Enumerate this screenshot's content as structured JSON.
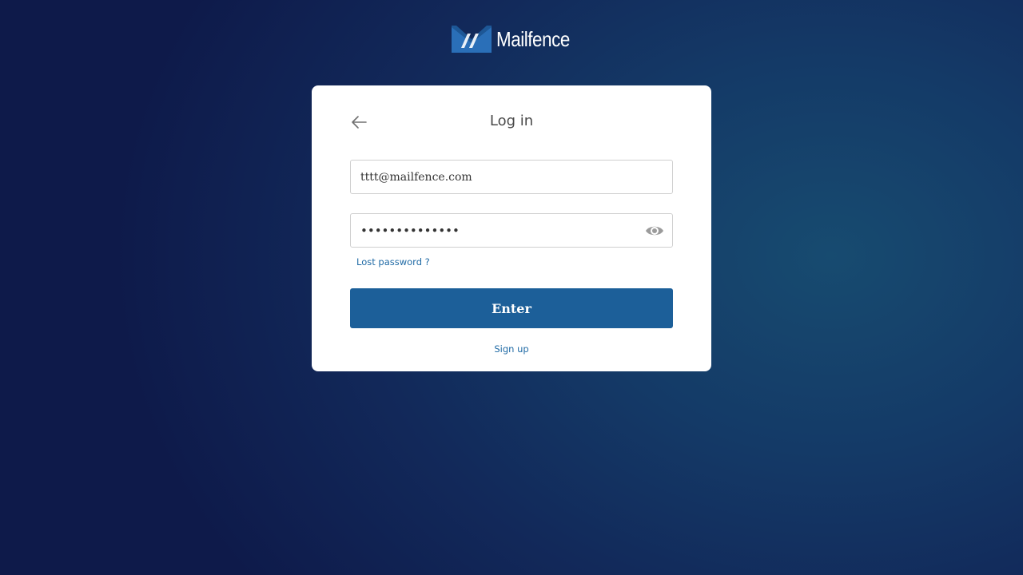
{
  "brand": {
    "name": "Mailfence",
    "logo_icon": "mailfence-envelope-logo",
    "accent_color": "#1c5f99",
    "logo_color": "#2a6fb8"
  },
  "login": {
    "title": "Log in",
    "back_icon": "arrow-left-icon",
    "email": {
      "value": "tttt@mailfence.com"
    },
    "password": {
      "masked_value": "••••••••••••••",
      "toggle_icon": "eye-icon"
    },
    "lost_password_label": "Lost password ?",
    "enter_label": "Enter",
    "signup_label": "Sign up"
  }
}
